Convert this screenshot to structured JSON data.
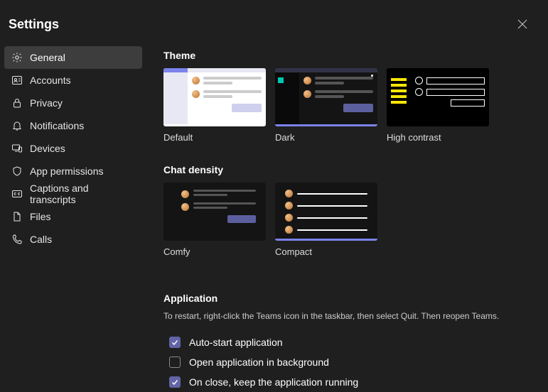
{
  "title": "Settings",
  "sidebar": {
    "items": [
      {
        "label": "General"
      },
      {
        "label": "Accounts"
      },
      {
        "label": "Privacy"
      },
      {
        "label": "Notifications"
      },
      {
        "label": "Devices"
      },
      {
        "label": "App permissions"
      },
      {
        "label": "Captions and transcripts"
      },
      {
        "label": "Files"
      },
      {
        "label": "Calls"
      }
    ]
  },
  "theme": {
    "heading": "Theme",
    "options": {
      "default": "Default",
      "dark": "Dark",
      "high_contrast": "High contrast"
    }
  },
  "density": {
    "heading": "Chat density",
    "options": {
      "comfy": "Comfy",
      "compact": "Compact"
    }
  },
  "application": {
    "heading": "Application",
    "description": "To restart, right-click the Teams icon in the taskbar, then select Quit. Then reopen Teams.",
    "checkboxes": {
      "auto_start": "Auto-start application",
      "open_bg": "Open application in background",
      "on_close": "On close, keep the application running"
    }
  }
}
